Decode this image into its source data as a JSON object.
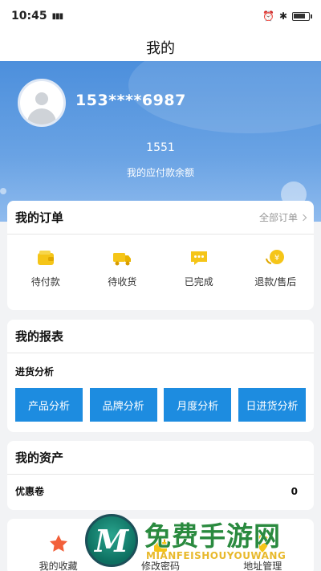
{
  "status": {
    "time": "10:45",
    "signal": "⁴ᴳııl",
    "battery_level": 0.85
  },
  "nav": {
    "title": "我的"
  },
  "profile": {
    "phone": "153****6987",
    "balance": "1551",
    "balance_label": "我的应付款余额"
  },
  "orders": {
    "title": "我的订单",
    "all_label": "全部订单",
    "items": [
      {
        "label": "待付款",
        "icon": "wallet-icon"
      },
      {
        "label": "待收货",
        "icon": "truck-icon"
      },
      {
        "label": "已完成",
        "icon": "chat-icon"
      },
      {
        "label": "退款/售后",
        "icon": "refund-icon"
      }
    ]
  },
  "reports": {
    "title": "我的报表",
    "section": "进货分析",
    "buttons": [
      "产品分析",
      "品牌分析",
      "月度分析",
      "日进货分析"
    ]
  },
  "assets": {
    "title": "我的资产",
    "coupon_label": "优惠卷",
    "coupon_value": "0"
  },
  "more": {
    "items": [
      {
        "label": "我的收藏",
        "icon": "star-icon"
      },
      {
        "label": "修改密码",
        "icon": "lock-icon"
      },
      {
        "label": "地址管理",
        "icon": "location-icon"
      }
    ]
  },
  "watermark": {
    "title": "免费手游网",
    "subtitle": "MIANFEISHOUYOUWANG",
    "logo_letter": "M"
  },
  "colors": {
    "accent": "#1d8ce0",
    "hero": "#4c8fdc",
    "icon_yellow": "#f5c518"
  }
}
